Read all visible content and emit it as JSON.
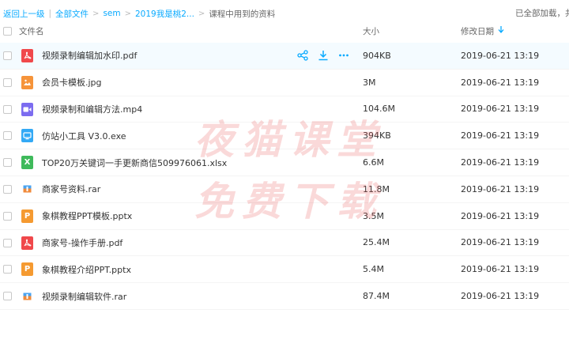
{
  "breadcrumb": {
    "back": "返回上一级",
    "all_files": "全部文件",
    "level1": "sem",
    "level2": "2019我是桃2...",
    "current": "课程中用到的资料"
  },
  "status": {
    "loaded": "已全部加载，共"
  },
  "columns": {
    "name": "文件名",
    "size": "大小",
    "date": "修改日期",
    "sort_icon": "arrow-down-icon"
  },
  "watermark": {
    "line1": "夜猫课堂",
    "line2": "免费下载"
  },
  "colors": {
    "accent": "#09aaff",
    "pdf": "#f0484b",
    "image": "#f6943a",
    "video": "#7c6cf0",
    "exe": "#33a9f5",
    "excel": "#3fba5b",
    "rar": "#f4b23f",
    "ppt": "#f59a31"
  },
  "files": [
    {
      "name": "视频录制编辑加水印.pdf",
      "size": "904KB",
      "date": "2019-06-21 13:19",
      "type": "pdf"
    },
    {
      "name": "会员卡模板.jpg",
      "size": "3M",
      "date": "2019-06-21 13:19",
      "type": "image"
    },
    {
      "name": "视频录制和编辑方法.mp4",
      "size": "104.6M",
      "date": "2019-06-21 13:19",
      "type": "video"
    },
    {
      "name": "仿站小工具 V3.0.exe",
      "size": "394KB",
      "date": "2019-06-21 13:19",
      "type": "exe"
    },
    {
      "name": "TOP20万关键词一手更新商信509976061.xlsx",
      "size": "6.6M",
      "date": "2019-06-21 13:19",
      "type": "excel"
    },
    {
      "name": "商家号资料.rar",
      "size": "11.8M",
      "date": "2019-06-21 13:19",
      "type": "rar"
    },
    {
      "name": "象棋教程PPT模板.pptx",
      "size": "3.5M",
      "date": "2019-06-21 13:19",
      "type": "ppt"
    },
    {
      "name": "商家号-操作手册.pdf",
      "size": "25.4M",
      "date": "2019-06-21 13:19",
      "type": "pdf"
    },
    {
      "name": "象棋教程介绍PPT.pptx",
      "size": "5.4M",
      "date": "2019-06-21 13:19",
      "type": "ppt"
    },
    {
      "name": "视频录制编辑软件.rar",
      "size": "87.4M",
      "date": "2019-06-21 13:19",
      "type": "rar"
    }
  ],
  "row_actions": [
    "share-icon",
    "download-icon",
    "more-icon"
  ]
}
